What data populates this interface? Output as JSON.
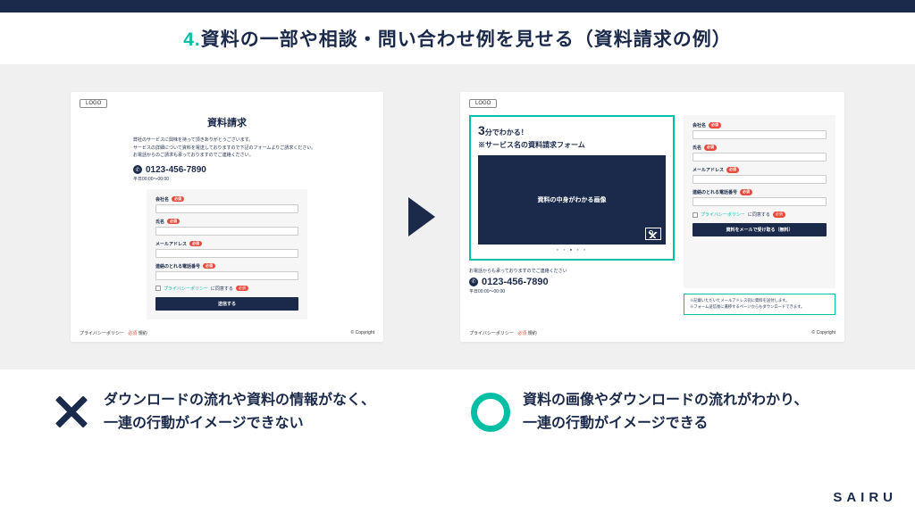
{
  "header": {
    "num": "4.",
    "title": "資料の一部や相談・問い合わせ例を見せる（資料請求の例）"
  },
  "logo": "LOGO",
  "left": {
    "title": "資料請求",
    "intro1": "弊社のサービスに興味を持って頂きありがとうございます。",
    "intro2": "サービスの詳細について資料を電送しておりますので下記のフォームよりご請求ください。",
    "intro3": "お電話からのご請求も承っておりますのでご連絡ください。",
    "tel": "0123-456-7890",
    "hours": "平日00:00〜00:00"
  },
  "form": {
    "f1": "会社名",
    "f2": "氏名",
    "f3": "メールアドレス",
    "f4": "連絡のとれる電話番号",
    "req": "必須",
    "pp": "プライバシーポリシー",
    "agree": "に同意する",
    "submit": "送信する",
    "submit2": "資料をメールで受け取る（無料）"
  },
  "right": {
    "h1": "分でわかる！",
    "h1num": "3",
    "h2": "※サービス名の資料請求フォーム",
    "preview": "資料の中身がわかる画像",
    "contact": "お電話からも承っておりますのでご連絡ください",
    "tel": "0123-456-7890",
    "hours": "平日00:00〜00:00",
    "note1": "※記載いただいたメールアドレス宛に資料を送付します。",
    "note2": "※フォーム送信後に遷移するページからもダウンロードできます。"
  },
  "footer": {
    "pp": "プライバシーポリシー",
    "terms": "規約",
    "copy": "© Copyright"
  },
  "bottom": {
    "bad": "ダウンロードの流れや資料の情報がなく、\n一連の行動がイメージできない",
    "good": "資料の画像やダウンロードの流れがわかり、\n一連の行動がイメージできる"
  },
  "brand": "SAIRU"
}
